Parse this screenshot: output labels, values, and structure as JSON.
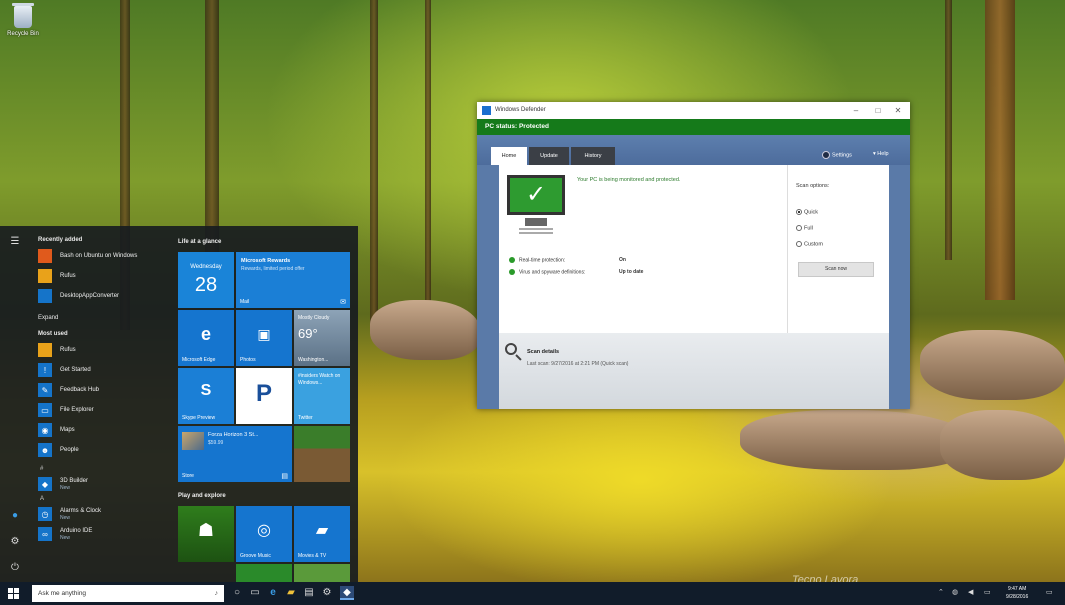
{
  "desktop": {
    "recycle_bin_label": "Recycle Bin",
    "watermark": "Tecno Lavora"
  },
  "start_menu": {
    "recently_added_header": "Recently added",
    "recently_added": [
      {
        "label": "Bash on Ubuntu on Windows"
      },
      {
        "label": "Rufus"
      },
      {
        "label": "DesktopAppConverter"
      }
    ],
    "expand_label": "Expand",
    "most_used_header": "Most used",
    "most_used": [
      {
        "label": "Rufus"
      },
      {
        "label": "Get Started"
      },
      {
        "label": "Feedback Hub"
      },
      {
        "label": "File Explorer"
      },
      {
        "label": "Maps"
      },
      {
        "label": "People"
      }
    ],
    "letter_number": "#",
    "number_app": {
      "label": "3D Builder",
      "sub": "New"
    },
    "letter_a": "A",
    "a_apps": [
      {
        "label": "Alarms & Clock",
        "sub": "New"
      },
      {
        "label": "Arduino IDE",
        "sub": "New"
      }
    ],
    "tiles_group1": "Life at a glance",
    "tiles_group2": "Play and explore",
    "tiles": {
      "calendar_day": "Wednesday",
      "calendar_date": "28",
      "mail_title": "Microsoft Rewards",
      "mail_sub": "Rewards, limited period offer",
      "mail_label": "Mail",
      "edge_label": "Microsoft Edge",
      "photos_label": "Photos",
      "weather_cond": "Mostly Cloudy",
      "weather_temp": "69°",
      "weather_city": "Washington...",
      "skype_label": "Skype Preview",
      "pandora_glyph": "P",
      "twitter_text": "#insiders Watch on Windows...",
      "twitter_label": "Twitter",
      "store_title": "Forza Horizon 3 St...",
      "store_price": "$59.99",
      "store_label": "Store",
      "minecraft_label": "",
      "groove_label": "Groove Music",
      "movies_label": "Movies & TV"
    }
  },
  "defender": {
    "title": "Windows Defender",
    "status": "PC status: Protected",
    "tabs": [
      {
        "label": "Home"
      },
      {
        "label": "Update"
      },
      {
        "label": "History"
      }
    ],
    "settings_label": "Settings",
    "help_label": "Help",
    "headline": "Your PC is being monitored and protected.",
    "rt_label": "Real-time protection:",
    "rt_value": "On",
    "defs_label": "Virus and spyware definitions:",
    "defs_value": "Up to date",
    "scan_options_title": "Scan options:",
    "scan_options": [
      {
        "label": "Quick"
      },
      {
        "label": "Full"
      },
      {
        "label": "Custom"
      }
    ],
    "scan_now_label": "Scan now",
    "details_title": "Scan details",
    "details_last_scan": "Last scan: 9/27/2016 at 2:21 PM (Quick scan)"
  },
  "taskbar": {
    "search_placeholder": "Ask me anything",
    "clock_time": "9:47 AM",
    "clock_date": "9/28/2016"
  }
}
